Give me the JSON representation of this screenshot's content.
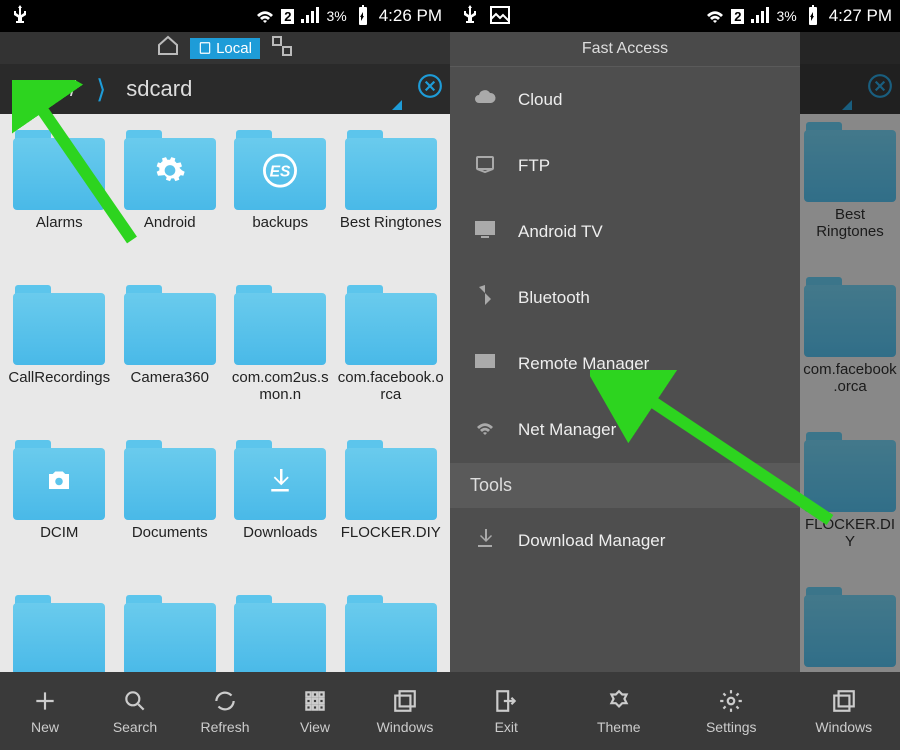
{
  "status": {
    "left_battery": "3%",
    "left_time": "4:26 PM",
    "right_battery": "3%",
    "right_time": "4:27 PM",
    "sim": "2"
  },
  "tabs": {
    "local": "Local"
  },
  "breadcrumb": {
    "root": "/",
    "current": "sdcard"
  },
  "folders": [
    {
      "label": "Alarms",
      "overlay": ""
    },
    {
      "label": "Android",
      "overlay": "gear"
    },
    {
      "label": "backups",
      "overlay": "es"
    },
    {
      "label": "Best Ringtones",
      "overlay": ""
    },
    {
      "label": "CallRecordings",
      "overlay": ""
    },
    {
      "label": "Camera360",
      "overlay": ""
    },
    {
      "label": "com.com2us.smon.n",
      "overlay": ""
    },
    {
      "label": "com.facebook.orca",
      "overlay": ""
    },
    {
      "label": "DCIM",
      "overlay": "camera"
    },
    {
      "label": "Documents",
      "overlay": ""
    },
    {
      "label": "Downloads",
      "overlay": "download"
    },
    {
      "label": "FLOCKER.DIY",
      "overlay": ""
    }
  ],
  "partial_row": [
    "",
    "",
    "",
    ""
  ],
  "bottom_left": [
    {
      "label": "New",
      "icon": "plus"
    },
    {
      "label": "Search",
      "icon": "search"
    },
    {
      "label": "Refresh",
      "icon": "refresh"
    },
    {
      "label": "View",
      "icon": "grid"
    },
    {
      "label": "Windows",
      "icon": "windows"
    }
  ],
  "bottom_right": [
    {
      "label": "Exit",
      "icon": "exit"
    },
    {
      "label": "Theme",
      "icon": "theme"
    },
    {
      "label": "Settings",
      "icon": "gear"
    },
    {
      "label": "Windows",
      "icon": "windows"
    }
  ],
  "drawer": {
    "header": "Fast Access",
    "items": [
      {
        "label": "Cloud",
        "icon": "cloud"
      },
      {
        "label": "FTP",
        "icon": "ftp"
      },
      {
        "label": "Android TV",
        "icon": "tv"
      },
      {
        "label": "Bluetooth",
        "icon": "bt"
      },
      {
        "label": "Remote Manager",
        "icon": "remote"
      },
      {
        "label": "Net Manager",
        "icon": "net"
      }
    ],
    "section": "Tools",
    "items2": [
      {
        "label": "Download Manager",
        "icon": "download"
      }
    ]
  },
  "right_visible_folders": [
    {
      "label": "Best Ringtones"
    },
    {
      "label": "com.facebook.orca"
    },
    {
      "label": "FLOCKER.DIY"
    }
  ]
}
